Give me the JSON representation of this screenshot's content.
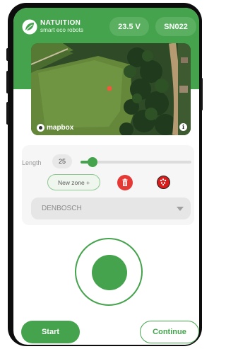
{
  "brand": {
    "name": "NATUITION",
    "tagline": "smart eco robots"
  },
  "header": {
    "voltage": "23.5 V",
    "device_id": "SN022"
  },
  "map": {
    "attribution": "mapbox",
    "info_label": "i"
  },
  "length": {
    "label": "Length",
    "value": "25",
    "slider_fraction": 0.11
  },
  "zone": {
    "new_zone_label": "New zone +"
  },
  "location_select": {
    "selected": "DENBOSCH"
  },
  "footer": {
    "start_label": "Start",
    "continue_label": "Continue"
  },
  "colors": {
    "brand_green": "#44a34c",
    "delete_red": "#e53935",
    "robot_red": "#d81b1b"
  },
  "icons": [
    "leaf-logo-icon",
    "mapbox-logo-icon",
    "info-icon",
    "trash-icon",
    "robot-icon",
    "chevron-down-icon"
  ]
}
